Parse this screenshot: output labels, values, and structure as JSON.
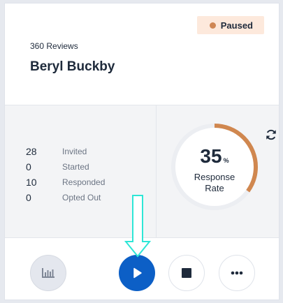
{
  "status": {
    "label": "Paused",
    "color": "#cf8755"
  },
  "header": {
    "subtitle": "360 Reviews",
    "title": "Beryl Buckby"
  },
  "stats": [
    {
      "value": "28",
      "label": "Invited"
    },
    {
      "value": "0",
      "label": "Started"
    },
    {
      "value": "10",
      "label": "Responded"
    },
    {
      "value": "0",
      "label": "Opted Out"
    }
  ],
  "response_rate": {
    "value": "35",
    "unit": "%",
    "label_line1": "Response",
    "label_line2": "Rate",
    "fraction": 0.35,
    "accent": "#d0874f"
  },
  "icons": {
    "refresh": "refresh-icon",
    "chart": "bar-chart-icon",
    "play": "play-icon",
    "stop": "stop-icon",
    "more": "more-horizontal-icon",
    "arrow": "down-arrow-icon"
  },
  "colors": {
    "primary": "#0c5fc6",
    "arrow": "#2ee6d6"
  }
}
